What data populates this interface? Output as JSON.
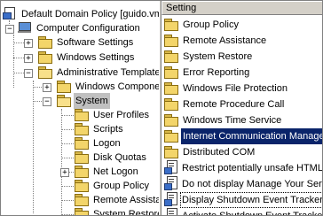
{
  "tree": {
    "root": "Default Domain Policy [guido.vmware.com] Policy",
    "computer_configuration": "Computer Configuration",
    "software_settings": "Software Settings",
    "windows_settings": "Windows Settings",
    "administrative_templates": "Administrative Templates",
    "windows_components": "Windows Components",
    "system": "System",
    "children": [
      "User Profiles",
      "Scripts",
      "Logon",
      "Disk Quotas",
      "Net Logon",
      "Group Policy",
      "Remote Assistance",
      "System Restore"
    ]
  },
  "list": {
    "header": "Setting",
    "folders": [
      "Group Policy",
      "Remote Assistance",
      "System Restore",
      "Error Reporting",
      "Windows File Protection",
      "Remote Procedure Call",
      "Windows Time Service",
      "Internet Communication Management",
      "Distributed COM"
    ],
    "settings": [
      "Restrict potentially unsafe HTML Help functions",
      "Do not display Manage Your Server page at logon",
      "Display Shutdown Event Tracker",
      "Activate Shutdown Event Tracker System State Data feature"
    ]
  },
  "colors": {
    "selection": "#0a246a",
    "folder": "#f3d56a",
    "chrome": "#d4d0c8"
  }
}
